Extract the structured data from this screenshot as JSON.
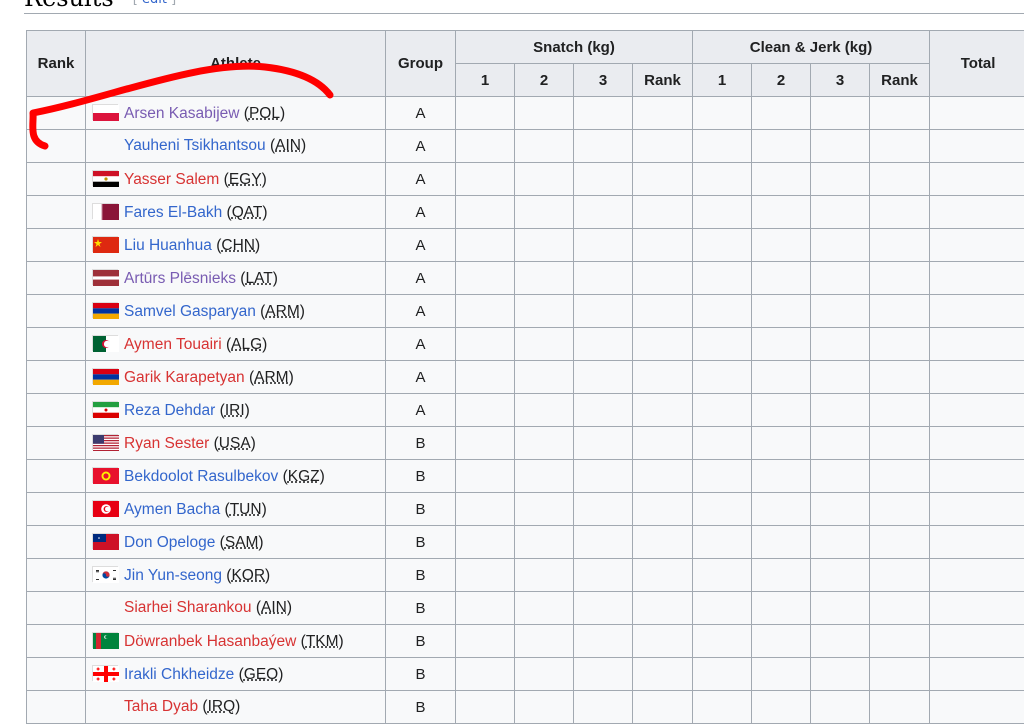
{
  "section": {
    "title": "Results",
    "edit_label": "edit"
  },
  "headers": {
    "rank": "Rank",
    "athlete": "Athlete",
    "group": "Group",
    "snatch": "Snatch (kg)",
    "clean_jerk": "Clean & Jerk (kg)",
    "total": "Total",
    "sub": [
      "1",
      "2",
      "3",
      "Rank",
      "1",
      "2",
      "3",
      "Rank"
    ]
  },
  "athletes": [
    {
      "name": "Arsen Kasabijew",
      "noc": "POL",
      "group": "A",
      "link": "visited",
      "flag": "poland-flag"
    },
    {
      "name": "Yauheni Tsikhantsou",
      "noc": "AIN",
      "group": "A",
      "link": "blue",
      "flag": ""
    },
    {
      "name": "Yasser Salem",
      "noc": "EGY",
      "group": "A",
      "link": "red",
      "flag": "egypt-flag"
    },
    {
      "name": "Fares El-Bakh",
      "noc": "QAT",
      "group": "A",
      "link": "blue",
      "flag": "qatar-flag"
    },
    {
      "name": "Liu Huanhua",
      "noc": "CHN",
      "group": "A",
      "link": "blue",
      "flag": "china-flag"
    },
    {
      "name": "Artūrs Plēsnieks",
      "noc": "LAT",
      "group": "A",
      "link": "visited",
      "flag": "latvia-flag"
    },
    {
      "name": "Samvel Gasparyan",
      "noc": "ARM",
      "group": "A",
      "link": "blue",
      "flag": "armenia-flag"
    },
    {
      "name": "Aymen Touairi",
      "noc": "ALG",
      "group": "A",
      "link": "red",
      "flag": "algeria-flag"
    },
    {
      "name": "Garik Karapetyan",
      "noc": "ARM",
      "group": "A",
      "link": "red",
      "flag": "armenia-flag"
    },
    {
      "name": "Reza Dehdar",
      "noc": "IRI",
      "group": "A",
      "link": "blue",
      "flag": "iran-flag"
    },
    {
      "name": "Ryan Sester",
      "noc": "USA",
      "group": "B",
      "link": "red",
      "flag": "usa-flag"
    },
    {
      "name": "Bekdoolot Rasulbekov",
      "noc": "KGZ",
      "group": "B",
      "link": "blue",
      "flag": "kyrgyzstan-flag"
    },
    {
      "name": "Aymen Bacha",
      "noc": "TUN",
      "group": "B",
      "link": "blue",
      "flag": "tunisia-flag"
    },
    {
      "name": "Don Opeloge",
      "noc": "SAM",
      "group": "B",
      "link": "blue",
      "flag": "samoa-flag"
    },
    {
      "name": "Jin Yun-seong",
      "noc": "KOR",
      "group": "B",
      "link": "blue",
      "flag": "south-korea-flag"
    },
    {
      "name": "Siarhei Sharankou",
      "noc": "AIN",
      "group": "B",
      "link": "red",
      "flag": ""
    },
    {
      "name": "Döwranbek Hasanbaýew",
      "noc": "TKM",
      "group": "B",
      "link": "red",
      "flag": "turkmenistan-flag"
    },
    {
      "name": "Irakli Chkheidze",
      "noc": "GEO",
      "group": "B",
      "link": "blue",
      "flag": "georgia-flag"
    },
    {
      "name": "Taha Dyab",
      "noc": "IRQ",
      "group": "B",
      "link": "red",
      "flag": ""
    }
  ],
  "colors": {
    "link_blue": "#3366cc",
    "link_red": "#d73333",
    "link_visited": "#795cb2",
    "annotation": "#ff0000"
  }
}
